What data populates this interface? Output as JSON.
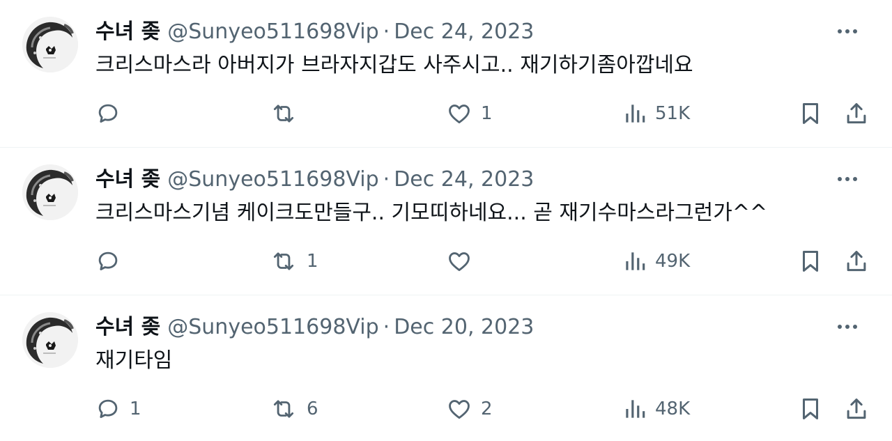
{
  "tweets": [
    {
      "name": "수녀 좆",
      "handle": "@Sunyeo511698Vip",
      "separator": "·",
      "date": "Dec 24, 2023",
      "text": "크리스마스라 아버지가 브라자지갑도 사주시고.. 재기하기좀아깝네요",
      "replies": "",
      "retweets": "",
      "likes": "1",
      "views": "51K"
    },
    {
      "name": "수녀 좆",
      "handle": "@Sunyeo511698Vip",
      "separator": "·",
      "date": "Dec 24, 2023",
      "text": "크리스마스기념 케이크도만들구.. 기모띠하네요... 곧 재기수마스라그런가^^",
      "replies": "",
      "retweets": "1",
      "likes": "",
      "views": "49K"
    },
    {
      "name": "수녀 좆",
      "handle": "@Sunyeo511698Vip",
      "separator": "·",
      "date": "Dec 20, 2023",
      "text": "재기타임",
      "replies": "1",
      "retweets": "6",
      "likes": "2",
      "views": "48K"
    }
  ],
  "icons": {
    "more": "more-horizontal-icon",
    "reply": "reply-bubble-icon",
    "retweet": "retweet-arrows-icon",
    "like": "heart-icon",
    "views": "views-bar-chart-icon",
    "bookmark": "bookmark-icon",
    "share": "share-upload-icon"
  },
  "colors": {
    "text_primary": "#0f1419",
    "text_secondary": "#536471",
    "divider": "#eff3f4"
  }
}
